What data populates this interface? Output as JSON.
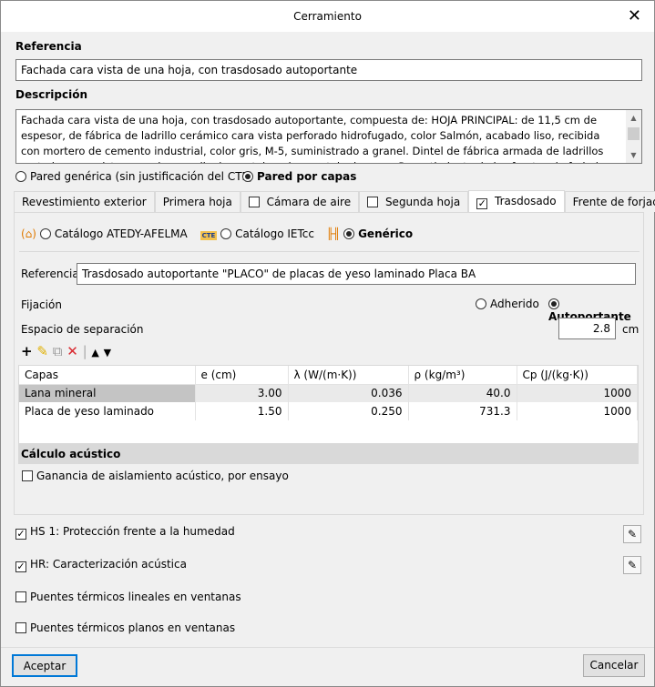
{
  "window": {
    "title": "Cerramiento",
    "close": "✕"
  },
  "referencia": {
    "label": "Referencia",
    "value": "Fachada cara vista de una hoja, con trasdosado autoportante"
  },
  "descripcion": {
    "label": "Descripción",
    "value": "Fachada cara vista de una hoja, con trasdosado autoportante, compuesta de: HOJA PRINCIPAL: de 11,5 cm de espesor, de fábrica de ladrillo cerámico cara vista perforado hidrofugado, color Salmón, acabado liso, recibida con mortero de cemento industrial, color gris, M-5, suministrado a granel. Dintel de fábrica armada de ladrillos cortados cara vista, aparejo a sardinel; montaje y desmontaje de apeo. Revestimiento de los frentes de forjado y pilares con ladrillos cortados, colocados con"
  },
  "wall_type": {
    "generic": "Pared genérica (sin justificación del CTE)",
    "layers": "Pared por capas"
  },
  "tabs": [
    {
      "label": "Revestimiento exterior"
    },
    {
      "label": "Primera hoja"
    },
    {
      "label": "Cámara de aire"
    },
    {
      "label": "Segunda hoja"
    },
    {
      "label": "Trasdosado"
    },
    {
      "label": "Frente de forjado"
    }
  ],
  "catalog": {
    "atedy": "Catálogo ATEDY-AFELMA",
    "ietcc": "Catálogo IETcc",
    "generico": "Genérico",
    "cte_badge": "CTE"
  },
  "trasdosado": {
    "ref_label": "Referencia",
    "ref_value": "Trasdosado autoportante \"PLACO\" de placas de yeso laminado Placa BA",
    "fijacion_label": "Fijación",
    "adherido": "Adherido",
    "autoportante": "Autoportante",
    "espacio_label": "Espacio de separación",
    "espacio_value": "2.8",
    "espacio_unit": "cm"
  },
  "table": {
    "headers": [
      "Capas",
      "e (cm)",
      "λ (W/(m·K))",
      "ρ (kg/m³)",
      "Cp (J/(kg·K))"
    ],
    "rows": [
      [
        "Lana mineral",
        "3.00",
        "0.036",
        "40.0",
        "1000"
      ],
      [
        "Placa de yeso laminado",
        "1.50",
        "0.250",
        "731.3",
        "1000"
      ]
    ]
  },
  "acoustic": {
    "title": "Cálculo acústico",
    "checkbox": "Ganancia de aislamiento acústico, por ensayo"
  },
  "options": [
    {
      "label": "HS 1: Protección frente a la humedad",
      "checked": true
    },
    {
      "label": "HR: Caracterización acústica",
      "checked": true
    },
    {
      "label": "Puentes térmicos lineales en ventanas",
      "checked": false
    },
    {
      "label": "Puentes térmicos planos en ventanas",
      "checked": false
    }
  ],
  "footer": {
    "accept": "Aceptar",
    "cancel": "Cancelar"
  }
}
